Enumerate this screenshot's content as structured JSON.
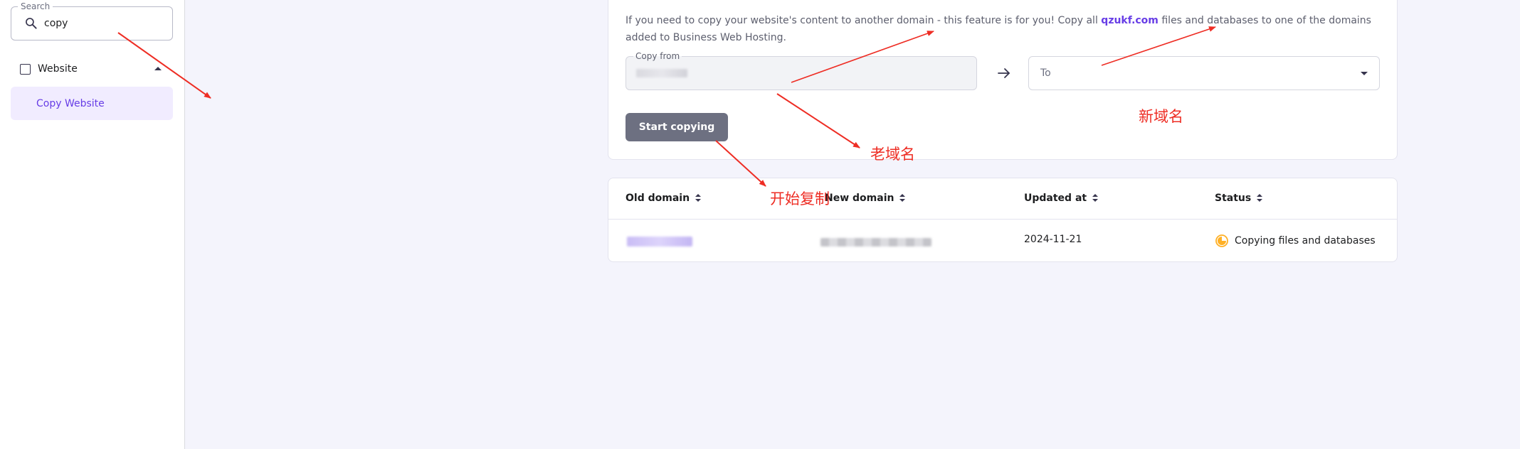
{
  "sidebar": {
    "search": {
      "legend": "Search",
      "value": "copy",
      "placeholder": ""
    },
    "group": {
      "label": "Website"
    },
    "active_item": {
      "label": "Copy Website"
    }
  },
  "copy_card": {
    "description_before": "If you need to copy your website's content to another domain - this feature is for you! Copy all ",
    "description_link": "qzukf.com",
    "description_after": " files and databases to one of the domains added to Business Web Hosting.",
    "copy_from_label": "Copy from",
    "to_placeholder": "To",
    "start_button": "Start copying"
  },
  "table": {
    "columns": [
      "Old domain",
      "New domain",
      "Updated at",
      "Status"
    ],
    "rows": [
      {
        "updated_at": "2024-11-21",
        "status": "Copying files and databases"
      }
    ]
  },
  "annotations": {
    "new_domain": "新域名",
    "old_domain": "老域名",
    "start_copy": "开始复制"
  },
  "colors": {
    "accent": "#673de6",
    "annotation": "#ee2d24",
    "button": "#6d7081",
    "status_pending": "#ffb025"
  }
}
